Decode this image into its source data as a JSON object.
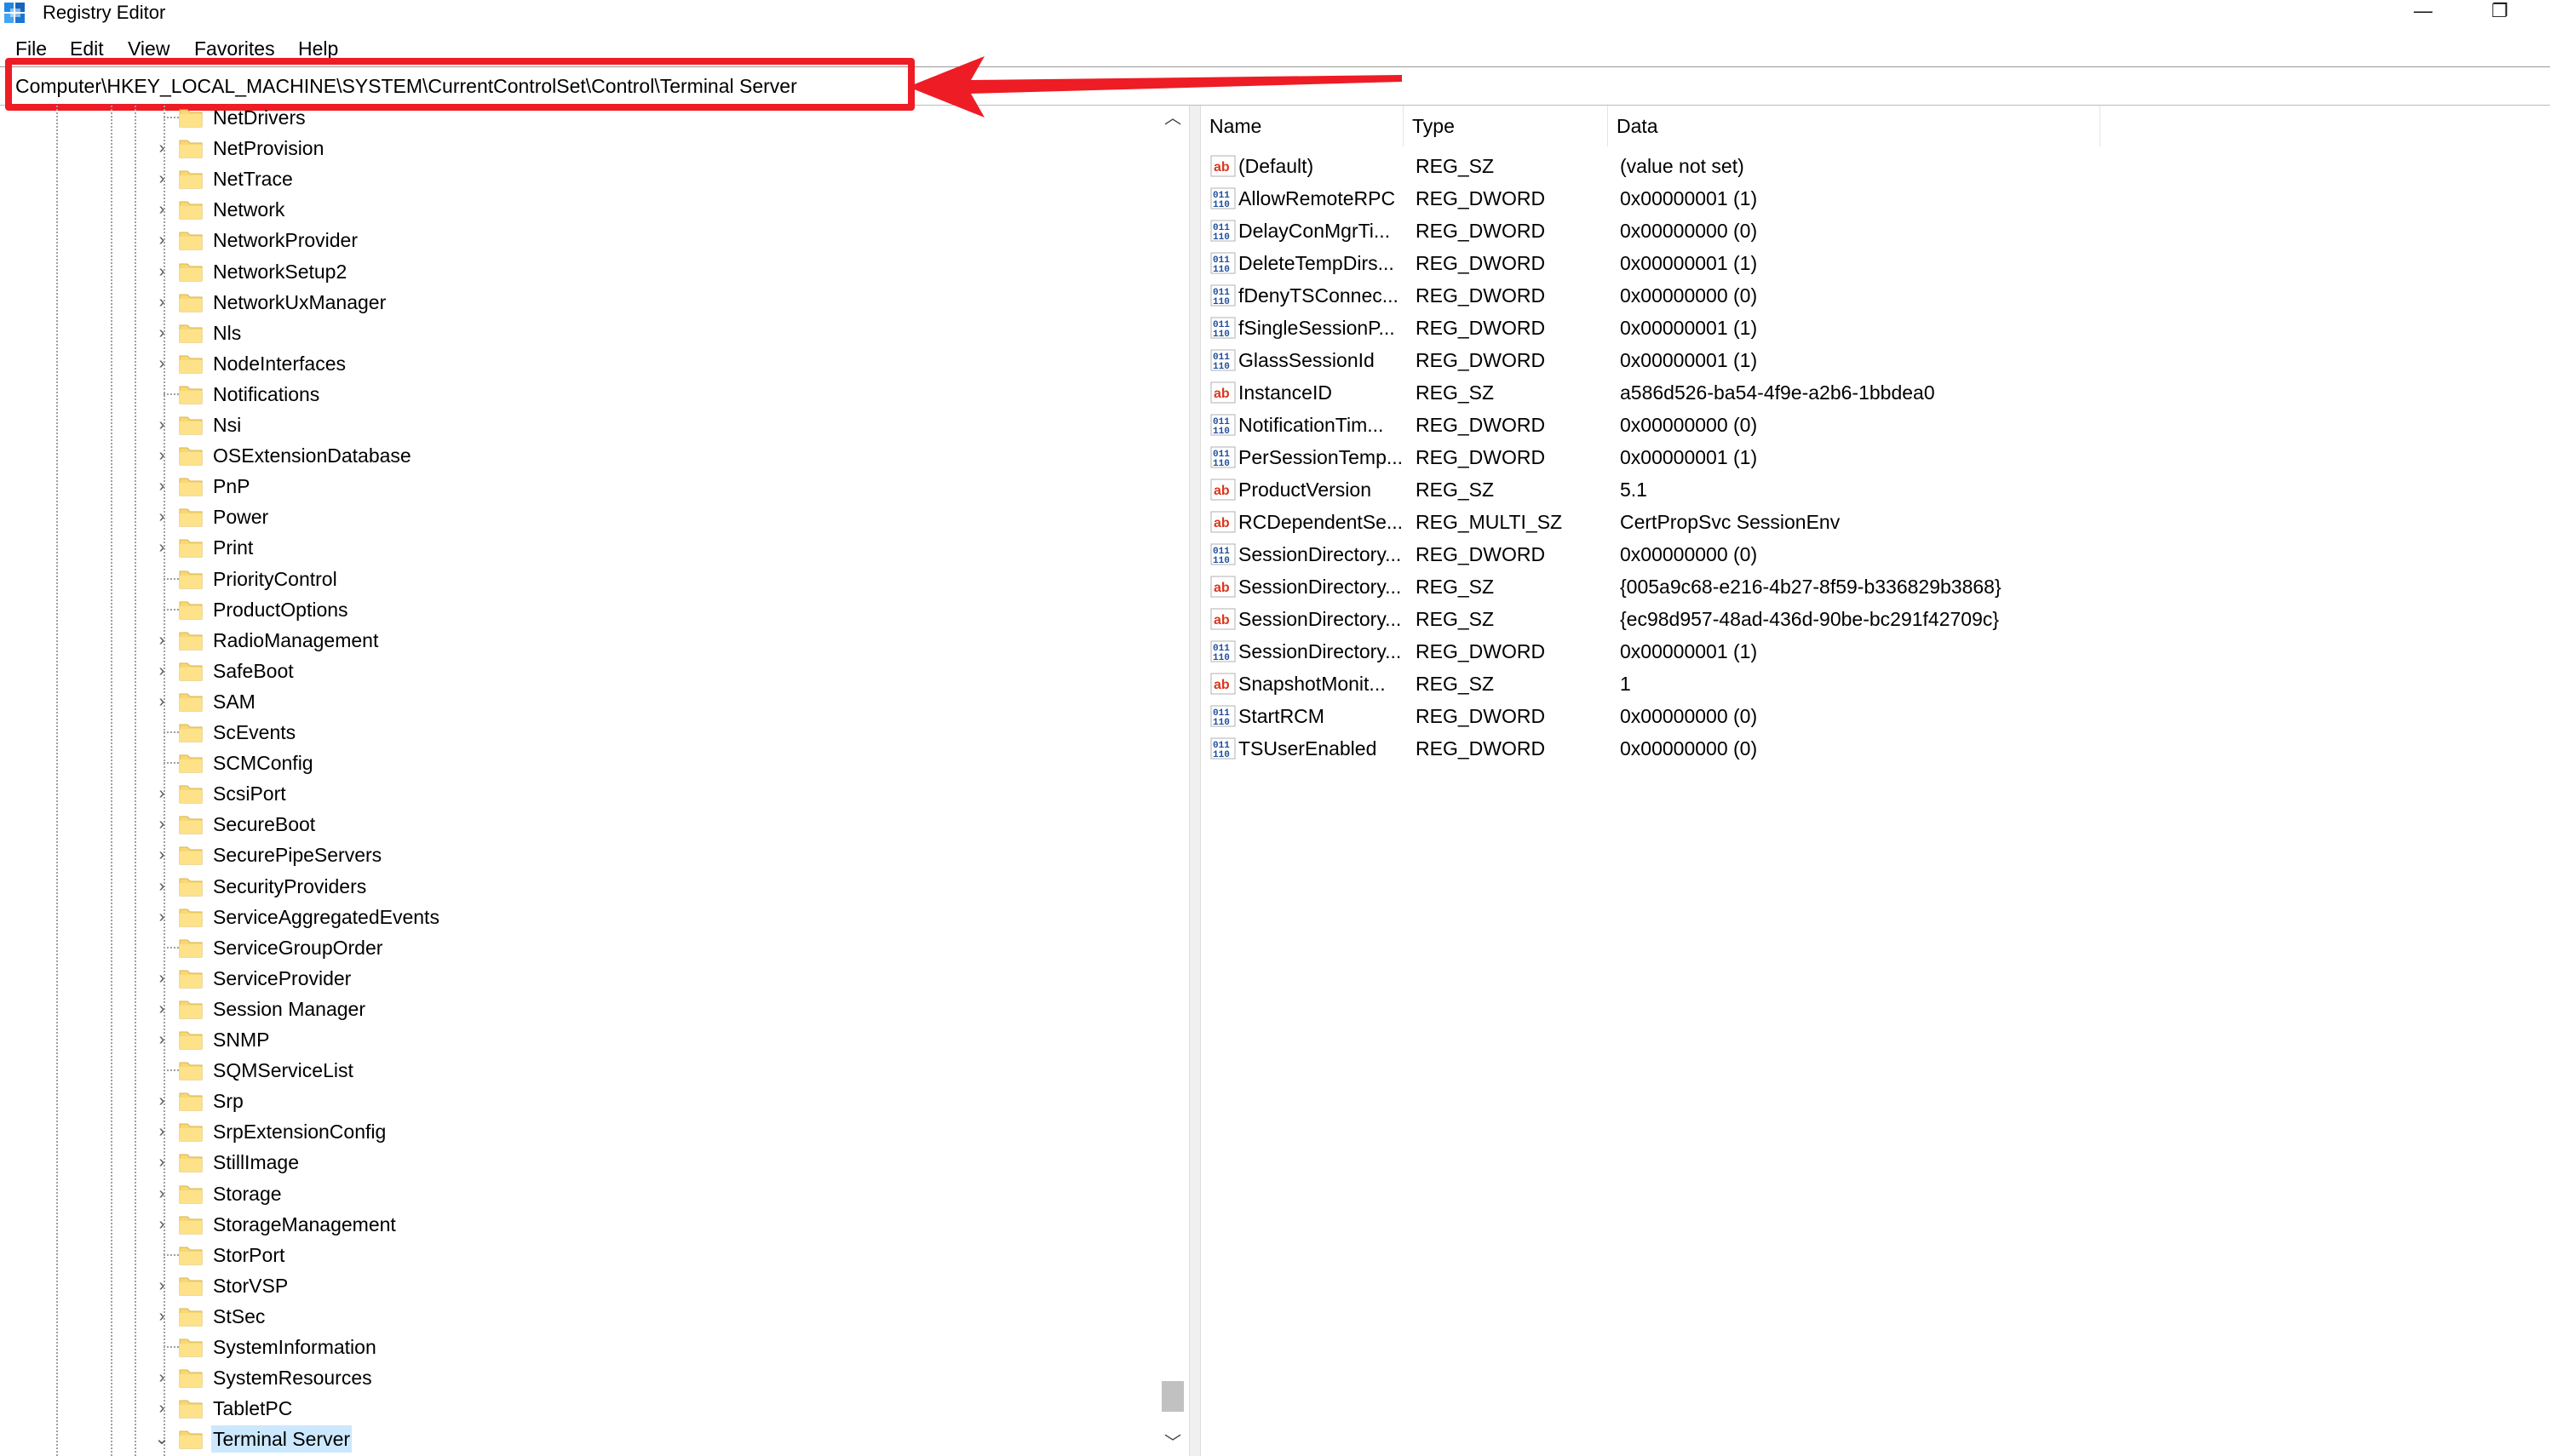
{
  "window": {
    "title": "Registry Editor",
    "minimize": "—",
    "maximize": "❐"
  },
  "menu": [
    "File",
    "Edit",
    "View",
    "Favorites",
    "Help"
  ],
  "address": "Computer\\HKEY_LOCAL_MACHINE\\SYSTEM\\CurrentControlSet\\Control\\Terminal Server",
  "annotation_color": "#ee1c24",
  "tree": [
    {
      "label": "NetDrivers",
      "expandable": false
    },
    {
      "label": "NetProvision",
      "expandable": true
    },
    {
      "label": "NetTrace",
      "expandable": true
    },
    {
      "label": "Network",
      "expandable": true
    },
    {
      "label": "NetworkProvider",
      "expandable": true
    },
    {
      "label": "NetworkSetup2",
      "expandable": true
    },
    {
      "label": "NetworkUxManager",
      "expandable": true
    },
    {
      "label": "Nls",
      "expandable": true
    },
    {
      "label": "NodeInterfaces",
      "expandable": true
    },
    {
      "label": "Notifications",
      "expandable": false
    },
    {
      "label": "Nsi",
      "expandable": true
    },
    {
      "label": "OSExtensionDatabase",
      "expandable": true
    },
    {
      "label": "PnP",
      "expandable": true
    },
    {
      "label": "Power",
      "expandable": true
    },
    {
      "label": "Print",
      "expandable": true
    },
    {
      "label": "PriorityControl",
      "expandable": false
    },
    {
      "label": "ProductOptions",
      "expandable": false
    },
    {
      "label": "RadioManagement",
      "expandable": true
    },
    {
      "label": "SafeBoot",
      "expandable": true
    },
    {
      "label": "SAM",
      "expandable": true
    },
    {
      "label": "ScEvents",
      "expandable": false
    },
    {
      "label": "SCMConfig",
      "expandable": false
    },
    {
      "label": "ScsiPort",
      "expandable": true
    },
    {
      "label": "SecureBoot",
      "expandable": true
    },
    {
      "label": "SecurePipeServers",
      "expandable": true
    },
    {
      "label": "SecurityProviders",
      "expandable": true
    },
    {
      "label": "ServiceAggregatedEvents",
      "expandable": true
    },
    {
      "label": "ServiceGroupOrder",
      "expandable": false
    },
    {
      "label": "ServiceProvider",
      "expandable": true
    },
    {
      "label": "Session Manager",
      "expandable": true
    },
    {
      "label": "SNMP",
      "expandable": true
    },
    {
      "label": "SQMServiceList",
      "expandable": false
    },
    {
      "label": "Srp",
      "expandable": true
    },
    {
      "label": "SrpExtensionConfig",
      "expandable": true
    },
    {
      "label": "StillImage",
      "expandable": true
    },
    {
      "label": "Storage",
      "expandable": true
    },
    {
      "label": "StorageManagement",
      "expandable": true
    },
    {
      "label": "StorPort",
      "expandable": false
    },
    {
      "label": "StorVSP",
      "expandable": true
    },
    {
      "label": "StSec",
      "expandable": true
    },
    {
      "label": "SystemInformation",
      "expandable": false
    },
    {
      "label": "SystemResources",
      "expandable": true
    },
    {
      "label": "TabletPC",
      "expandable": true
    },
    {
      "label": "Terminal Server",
      "expandable": true,
      "expanded": true,
      "selected": true
    }
  ],
  "list": {
    "headers": {
      "name": "Name",
      "type": "Type",
      "data": "Data"
    },
    "rows": [
      {
        "icon": "string",
        "name": "(Default)",
        "type": "REG_SZ",
        "data": "(value not set)"
      },
      {
        "icon": "binary",
        "name": "AllowRemoteRPC",
        "type": "REG_DWORD",
        "data": "0x00000001 (1)"
      },
      {
        "icon": "binary",
        "name": "DelayConMgrTi...",
        "type": "REG_DWORD",
        "data": "0x00000000 (0)"
      },
      {
        "icon": "binary",
        "name": "DeleteTempDirs...",
        "type": "REG_DWORD",
        "data": "0x00000001 (1)"
      },
      {
        "icon": "binary",
        "name": "fDenyTSConnec...",
        "type": "REG_DWORD",
        "data": "0x00000000 (0)"
      },
      {
        "icon": "binary",
        "name": "fSingleSessionP...",
        "type": "REG_DWORD",
        "data": "0x00000001 (1)"
      },
      {
        "icon": "binary",
        "name": "GlassSessionId",
        "type": "REG_DWORD",
        "data": "0x00000001 (1)"
      },
      {
        "icon": "string",
        "name": "InstanceID",
        "type": "REG_SZ",
        "data": "a586d526-ba54-4f9e-a2b6-1bbdea0"
      },
      {
        "icon": "binary",
        "name": "NotificationTim...",
        "type": "REG_DWORD",
        "data": "0x00000000 (0)"
      },
      {
        "icon": "binary",
        "name": "PerSessionTemp...",
        "type": "REG_DWORD",
        "data": "0x00000001 (1)"
      },
      {
        "icon": "string",
        "name": "ProductVersion",
        "type": "REG_SZ",
        "data": "5.1"
      },
      {
        "icon": "string",
        "name": "RCDependentSe...",
        "type": "REG_MULTI_SZ",
        "data": "CertPropSvc SessionEnv"
      },
      {
        "icon": "binary",
        "name": "SessionDirectory...",
        "type": "REG_DWORD",
        "data": "0x00000000 (0)"
      },
      {
        "icon": "string",
        "name": "SessionDirectory...",
        "type": "REG_SZ",
        "data": "{005a9c68-e216-4b27-8f59-b336829b3868}"
      },
      {
        "icon": "string",
        "name": "SessionDirectory...",
        "type": "REG_SZ",
        "data": "{ec98d957-48ad-436d-90be-bc291f42709c}"
      },
      {
        "icon": "binary",
        "name": "SessionDirectory...",
        "type": "REG_DWORD",
        "data": "0x00000001 (1)"
      },
      {
        "icon": "string",
        "name": "SnapshotMonit...",
        "type": "REG_SZ",
        "data": "1"
      },
      {
        "icon": "binary",
        "name": "StartRCM",
        "type": "REG_DWORD",
        "data": "0x00000000 (0)"
      },
      {
        "icon": "binary",
        "name": "TSUserEnabled",
        "type": "REG_DWORD",
        "data": "0x00000000 (0)"
      }
    ]
  }
}
